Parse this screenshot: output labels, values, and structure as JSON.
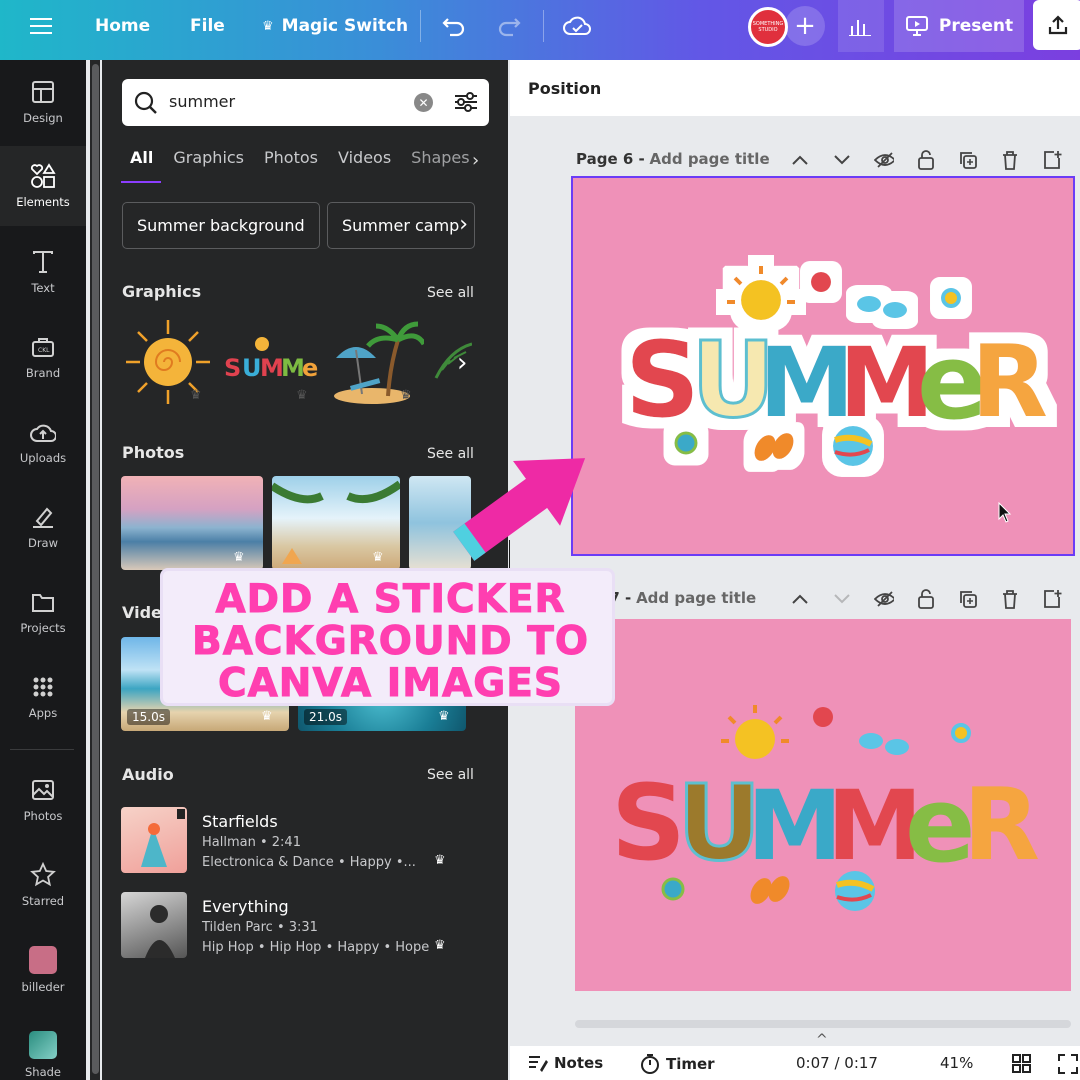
{
  "topbar": {
    "home": "Home",
    "file": "File",
    "magic_switch": "Magic Switch",
    "present": "Present",
    "avatar_text": "SOMETHING STUDIO"
  },
  "rail": {
    "items": [
      {
        "label": "Design",
        "icon": "layout-icon"
      },
      {
        "label": "Elements",
        "icon": "shapes-icon"
      },
      {
        "label": "Text",
        "icon": "text-icon"
      },
      {
        "label": "Brand",
        "icon": "brand-icon"
      },
      {
        "label": "Uploads",
        "icon": "cloud-upload-icon"
      },
      {
        "label": "Draw",
        "icon": "pen-icon"
      },
      {
        "label": "Projects",
        "icon": "folder-icon"
      },
      {
        "label": "Apps",
        "icon": "apps-grid-icon"
      },
      {
        "label": "Photos",
        "icon": "image-icon"
      },
      {
        "label": "Starred",
        "icon": "star-icon"
      },
      {
        "label": "billeder",
        "icon": "folder-thumb-icon"
      },
      {
        "label": "Shade",
        "icon": "folder-thumb-icon"
      }
    ]
  },
  "panel": {
    "search_value": "summer",
    "tabs": [
      "All",
      "Graphics",
      "Photos",
      "Videos",
      "Shapes"
    ],
    "chips": [
      "Summer background",
      "Summer camp"
    ],
    "graphics_title": "Graphics",
    "photos_title": "Photos",
    "videos_title": "Vide",
    "audio_title": "Audio",
    "see_all": "See all",
    "videos": [
      {
        "duration": "15.0s"
      },
      {
        "duration": "21.0s"
      }
    ],
    "audio": [
      {
        "title": "Starfields",
        "meta": "Hallman • 2:41",
        "tags": "Electronica & Dance • Happy •..."
      },
      {
        "title": "Everything",
        "meta": "Tilden Parc • 3:31",
        "tags": "Hip Hop • Hip Hop • Happy • Hope"
      }
    ]
  },
  "editor": {
    "position": "Position",
    "page6_label": "Page 6 -",
    "page6_placeholder": "Add page title",
    "page7_label": "e 7 -",
    "page7_placeholder": "Add page title",
    "sticker_word": "SUMMER"
  },
  "bottom": {
    "notes": "Notes",
    "timer": "Timer",
    "time": "0:07 / 0:17",
    "zoom": "41%"
  },
  "overlay": {
    "line1": "ADD A STICKER",
    "line2": "BACKGROUND TO",
    "line3": "CANVA IMAGES"
  },
  "colors": {
    "accent": "#8b3dff",
    "page_bg": "#ef91b8",
    "overlay_text": "#ff3fb0",
    "arrow": "#ee2aa5"
  }
}
